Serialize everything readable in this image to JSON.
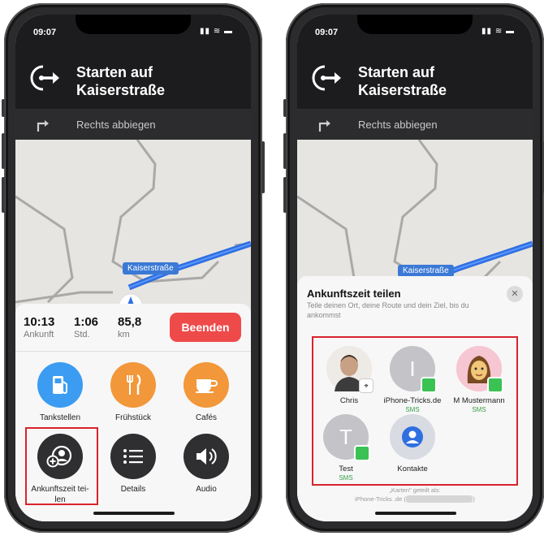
{
  "status_bar": {
    "time": "09:07",
    "icons": "▮▮ ≋ ▬"
  },
  "navigation": {
    "title_line1": "Starten auf",
    "title_line2": "Kaiserstraße",
    "next_instruction": "Rechts abbiegen",
    "street_label": "Kaiserstraße"
  },
  "trip": {
    "arrival_time": "10:13",
    "arrival_label": "Ankunft",
    "duration": "1:06",
    "duration_label": "Std.",
    "distance": "85,8",
    "distance_label": "km",
    "end_button": "Beenden"
  },
  "actions": [
    {
      "label": "Tankstellen",
      "icon": "fuel-icon"
    },
    {
      "label": "Frühstück",
      "icon": "fork-knife-icon"
    },
    {
      "label": "Cafés",
      "icon": "coffee-cup-icon"
    },
    {
      "label": "Ankunftszeit tei-",
      "label2": "len",
      "icon": "share-eta-icon"
    },
    {
      "label": "Details",
      "icon": "list-icon"
    },
    {
      "label": "Audio",
      "icon": "speaker-icon"
    }
  ],
  "share_sheet": {
    "title": "Ankunftszeit teilen",
    "description": "Teile deinen Ort, deine Route und dein Ziel, bis du ankommst",
    "contacts": [
      {
        "name": "Chris",
        "sub": "",
        "initial": ""
      },
      {
        "name": "iPhone-Tricks.de",
        "sub": "SMS",
        "initial": "I"
      },
      {
        "name": "M Mustermann",
        "sub": "SMS",
        "initial": ""
      },
      {
        "name": "Test",
        "sub": "SMS",
        "initial": "T"
      },
      {
        "name": "Kontakte",
        "sub": "",
        "initial": ""
      }
    ],
    "footer_line1": "„Karten\" geteilt als:",
    "footer_line2": "iPhone-Tricks .de ("
  },
  "colors": {
    "highlight": "#d9232e",
    "end_button": "#ef4a4a",
    "route": "#2f6fe0",
    "accent_blue": "#3b9cf2",
    "accent_orange": "#f2973a"
  }
}
